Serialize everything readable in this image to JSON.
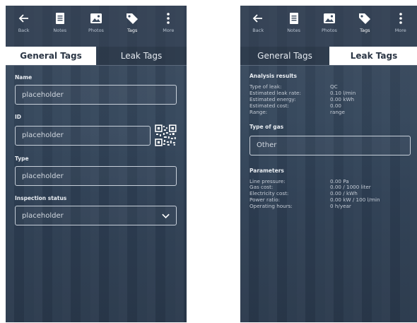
{
  "toolbar": {
    "back": "Back",
    "notes": "Notes",
    "photos": "Photos",
    "tags": "Tags",
    "more": "More"
  },
  "tabs": {
    "general": "General Tags",
    "leak": "Leak Tags"
  },
  "general": {
    "name_label": "Name",
    "name_value": "placeholder",
    "id_label": "ID",
    "id_value": "placeholder",
    "type_label": "Type",
    "type_value": "placeholder",
    "status_label": "Inspection status",
    "status_value": "placeholder"
  },
  "leak": {
    "analysis_title": "Analysis results",
    "analysis": [
      {
        "key": "Type of leak:",
        "value": "QC"
      },
      {
        "key": "Estimated leak rate:",
        "value": "0.10 l/min"
      },
      {
        "key": "Estimated energy:",
        "value": "0.00 kWh"
      },
      {
        "key": "Estimated cost:",
        "value": "0.00"
      },
      {
        "key": "Range:",
        "value": "range"
      }
    ],
    "gas_title": "Type of gas",
    "gas_value": "Other",
    "params_title": "Parameters",
    "params": [
      {
        "key": "Line pressure:",
        "value": "0.00 Pa"
      },
      {
        "key": "Gas cost:",
        "value": "0.00 / 1000 liter"
      },
      {
        "key": "Electricity cost:",
        "value": "0.00 / kWh"
      },
      {
        "key": "Power ratio:",
        "value": "0.00 kW / 100 l/min"
      },
      {
        "key": "Operating hours:",
        "value": "0 h/year"
      }
    ]
  },
  "colors": {
    "background": "#34465b",
    "active_tab": "#ffffff",
    "active_tab_text": "#2b3645",
    "field_border": "#c8d0da"
  }
}
